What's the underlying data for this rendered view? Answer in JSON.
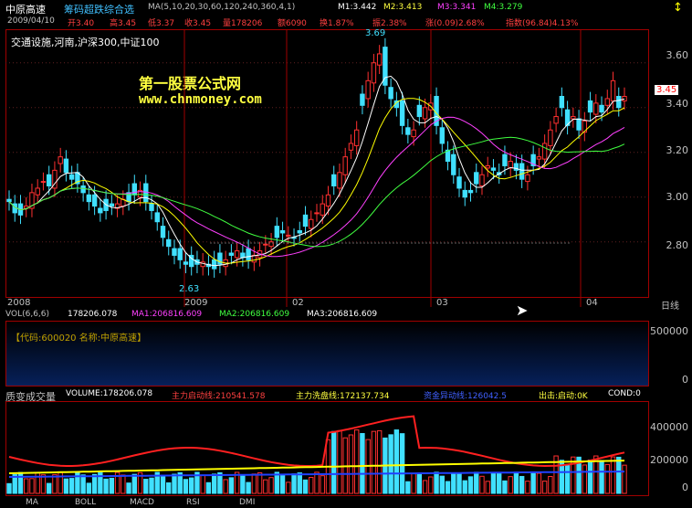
{
  "header": {
    "stock_name": "中原高速",
    "formula_name": "筹码超跌综合选",
    "ma_params": "MA(5,10,20,30,60,120,240,360,4,1)",
    "m1": "M1:3.442",
    "m2": "M2:3.413",
    "m3": "M3:3.341",
    "m4": "M4:3.279",
    "date": "2009/04/10",
    "open": "开3.40",
    "high": "高3.45",
    "low": "低3.37",
    "close": "收3.45",
    "volume": "量178206",
    "amount": "额6090",
    "turnover": "换1.87%",
    "amplitude": "振2.38%",
    "change": "涨(0.09)2.68%",
    "index": "指数(96.84)4.13%"
  },
  "sectors": "交通设施,河南,沪深300,中证100",
  "watermark": {
    "title": "第一股票公式网",
    "url": "www.chnmoney.com"
  },
  "price_axis": {
    "ticks": [
      "3.60",
      "3.40",
      "3.20",
      "3.00",
      "2.80"
    ],
    "current": "3.45"
  },
  "annotations": {
    "high": "3.69",
    "low": "2.63"
  },
  "time_axis": {
    "labels": [
      "2008",
      "2009",
      "02",
      "03",
      "04"
    ],
    "cycle": "日线"
  },
  "volume_panel": {
    "title": "VOL(6,6,6)",
    "value": "178206.078",
    "ma1": "MA1:206816.609",
    "ma2": "MA2:206816.609",
    "ma3": "MA3:206816.609",
    "code_label": "【代码:600020 名称:中原高速】",
    "ticks": [
      "500000",
      "0"
    ]
  },
  "indicator_panel": {
    "title": "质变成交量",
    "volume": "VOLUME:178206.078",
    "main_start": "主力启动线:210541.578",
    "main_wash": "主力洗盘线:172137.734",
    "fund_flow": "资金异动线:126042.5",
    "signal": "出击:启动:0K",
    "cond": "COND:0",
    "ticks": [
      "400000",
      "200000",
      "0"
    ]
  },
  "tabs": [
    "MA",
    "BOLL",
    "MACD",
    "RSI",
    "DMI"
  ],
  "colors": {
    "up": "#ff3030",
    "down": "#40e0ff",
    "grid": "#a00000",
    "ma5": "#ffffff",
    "ma10": "#ffff00",
    "ma20": "#ff40ff",
    "ma30": "#40ff40"
  },
  "chart_data": {
    "type": "candlestick",
    "dates_note": "",
    "ylim": [
      2.55,
      3.75
    ],
    "closes": [
      2.98,
      2.93,
      2.92,
      2.96,
      3.02,
      3.04,
      3.07,
      3.05,
      3.12,
      3.18,
      3.11,
      3.08,
      3.06,
      3.02,
      2.98,
      2.96,
      2.93,
      2.94,
      2.96,
      2.97,
      2.99,
      2.98,
      3.01,
      3.03,
      2.98,
      2.94,
      2.89,
      2.82,
      2.78,
      2.74,
      2.72,
      2.7,
      2.69,
      2.7,
      2.71,
      2.69,
      2.68,
      2.7,
      2.72,
      2.74,
      2.76,
      2.73,
      2.72,
      2.74,
      2.76,
      2.79,
      2.8,
      2.82,
      2.84,
      2.83,
      2.82,
      2.84,
      2.87,
      2.9,
      2.93,
      2.97,
      3.01,
      3.05,
      3.11,
      3.18,
      3.24,
      3.3,
      3.41,
      3.52,
      3.6,
      3.64,
      3.5,
      3.44,
      3.4,
      3.32,
      3.28,
      3.3,
      3.36,
      3.4,
      3.42,
      3.32,
      3.24,
      3.16,
      3.1,
      3.04,
      3.0,
      3.02,
      3.06,
      3.1,
      3.14,
      3.12,
      3.1,
      3.14,
      3.16,
      3.12,
      3.08,
      3.1,
      3.14,
      3.18,
      3.24,
      3.3,
      3.36,
      3.4,
      3.32,
      3.36,
      3.3,
      3.34,
      3.38,
      3.42,
      3.38,
      3.44,
      3.52,
      3.4,
      3.45
    ]
  }
}
